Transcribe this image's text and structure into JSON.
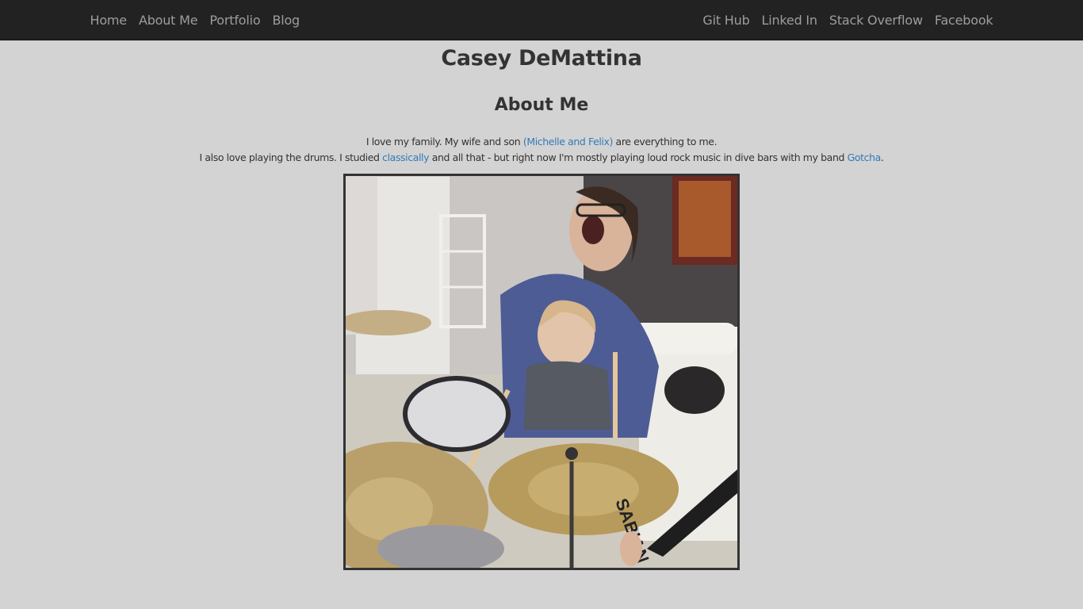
{
  "nav": {
    "left": [
      {
        "label": "Home"
      },
      {
        "label": "About Me"
      },
      {
        "label": "Portfolio"
      },
      {
        "label": "Blog"
      }
    ],
    "right": [
      {
        "label": "Git Hub"
      },
      {
        "label": "Linked In"
      },
      {
        "label": "Stack Overflow"
      },
      {
        "label": "Facebook"
      }
    ]
  },
  "site_title": "Casey DeMattina",
  "section_title": "About Me",
  "para1": {
    "before": "I love my family. My wife and son ",
    "link": "(Michelle and Felix)",
    "after": " are everything to me."
  },
  "para2": {
    "before": "I also love playing the drums. I studied ",
    "link1": "classically",
    "middle": " and all that - but right now I'm mostly playing loud rock music in dive bars with my band ",
    "link2": "Gotcha",
    "after": "."
  },
  "photo": {
    "cymbal_brand": "SABIAN"
  },
  "colors": {
    "navbar_bg": "#222222",
    "nav_text": "#9d9d9d",
    "page_bg": "#d3d3d3",
    "link": "#337ab7"
  }
}
